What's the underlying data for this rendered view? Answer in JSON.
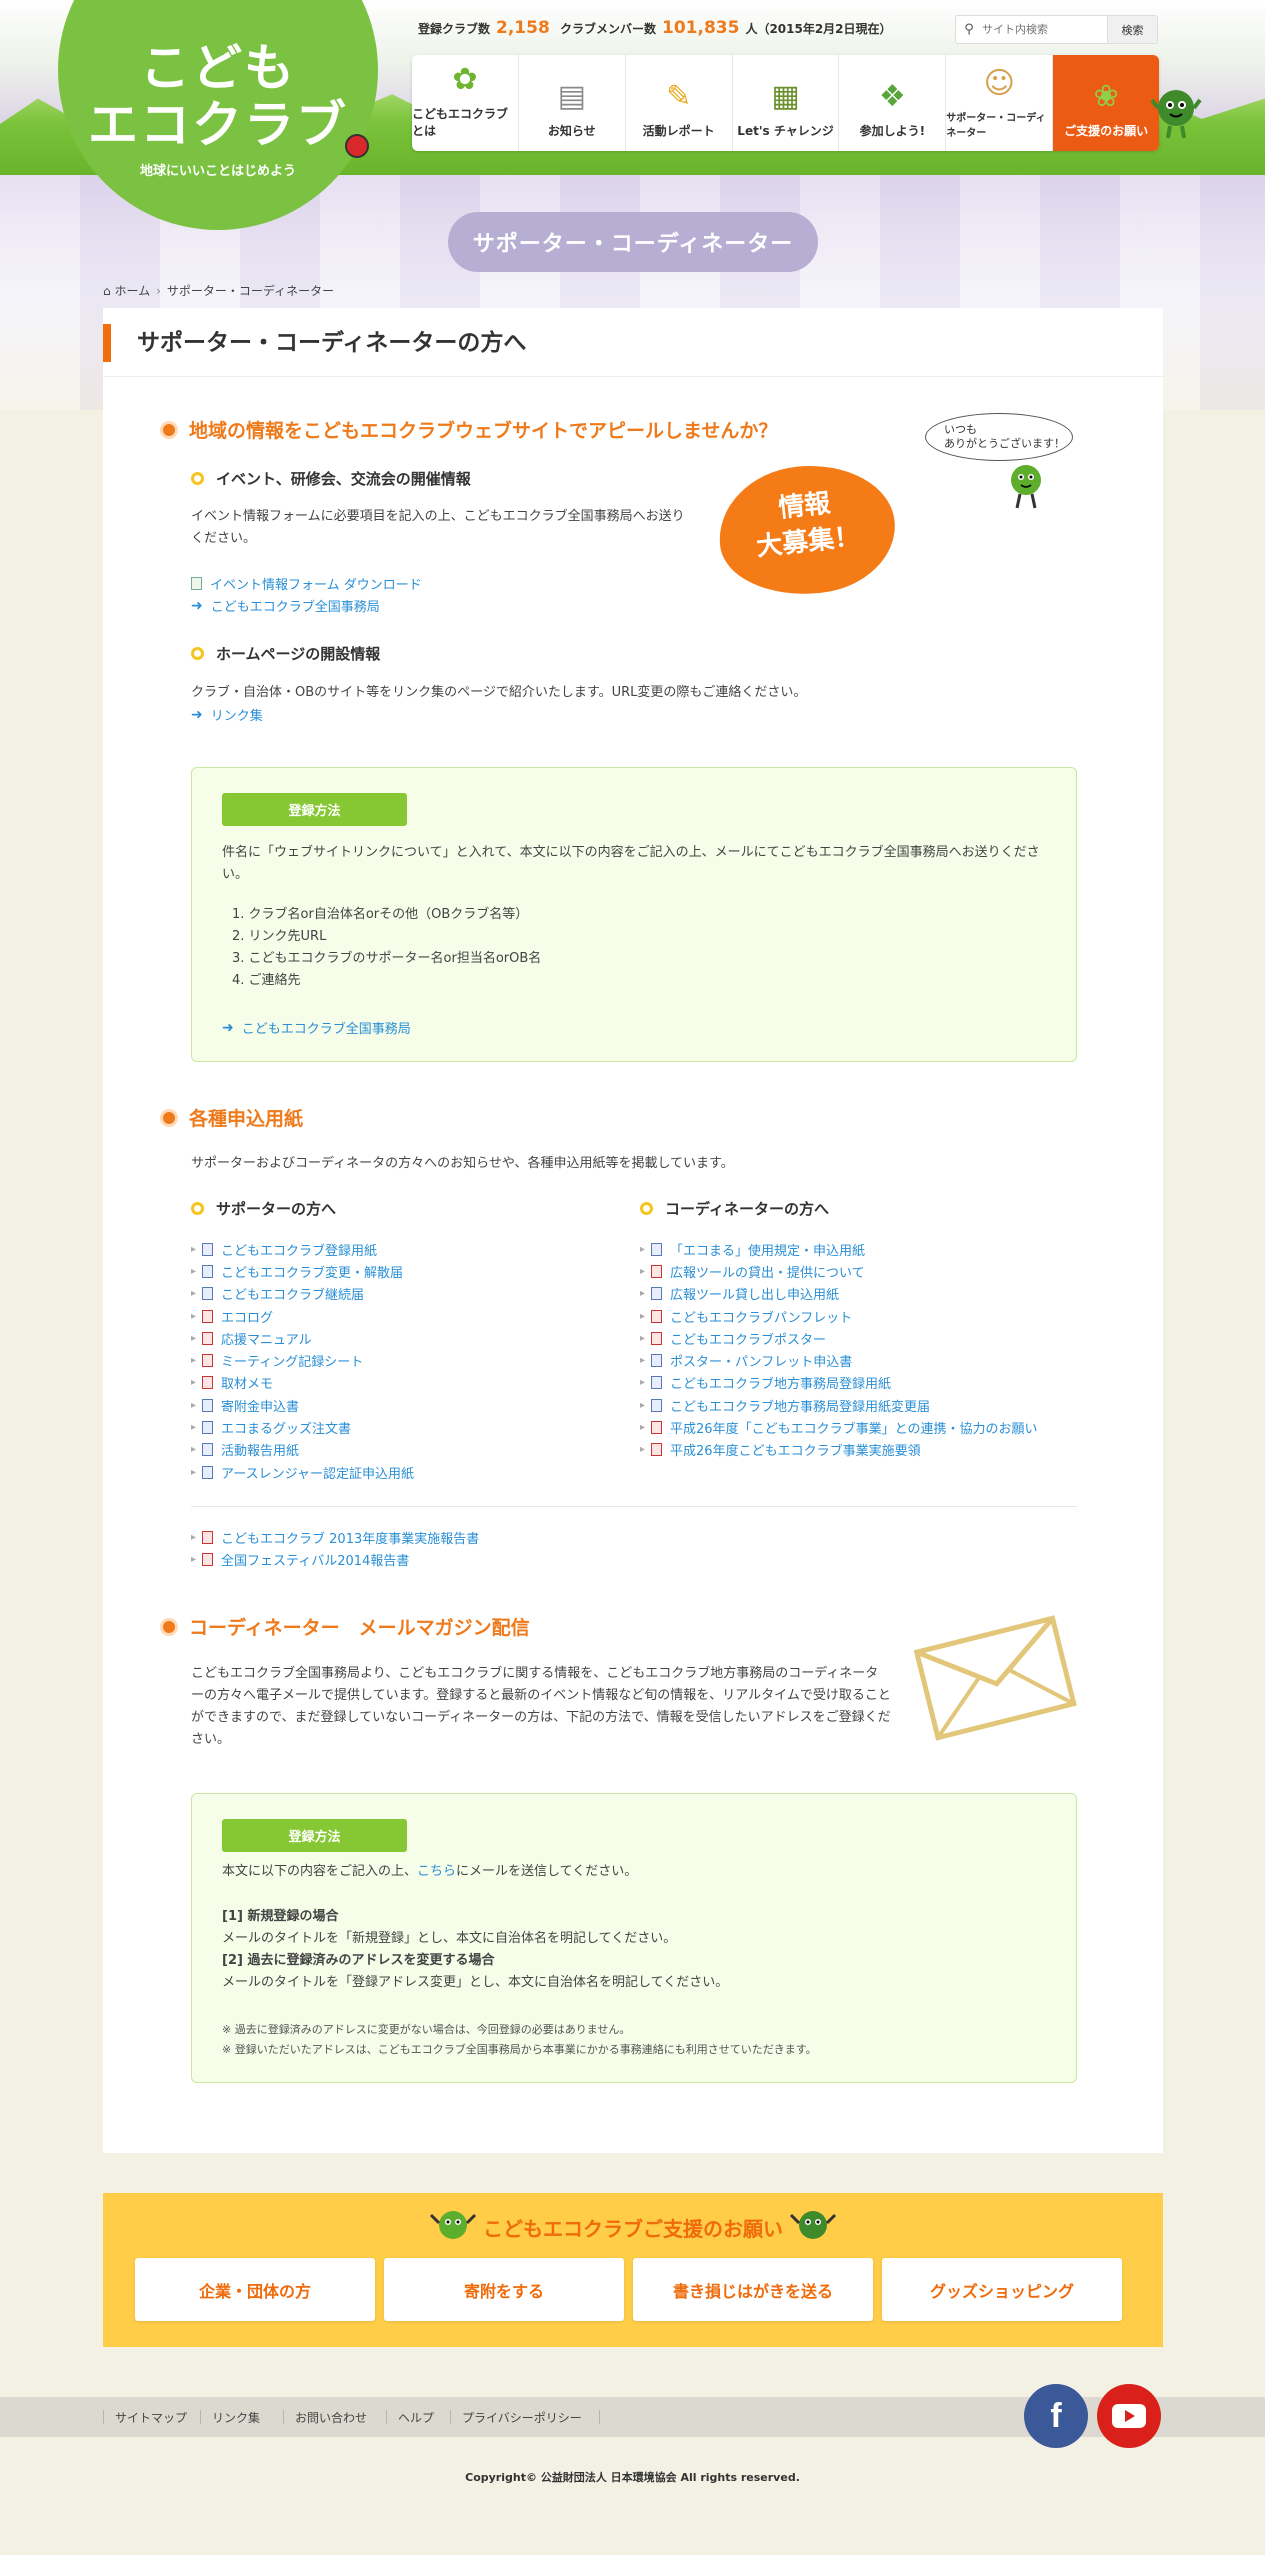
{
  "header": {
    "logo_line1": "こども",
    "logo_line2": "エコクラブ",
    "logo_tagline": "地球にいいことはじめよう",
    "stats_club_label": "登録クラブ数",
    "stats_club_count": "2,158",
    "stats_member_label": "クラブメンバー数",
    "stats_member_count": "101,835",
    "stats_member_suffix": "人（2015年2月2日現在）",
    "search_placeholder": "サイト内検索",
    "search_button": "検索",
    "nav": [
      {
        "label": "こどもエコクラブとは",
        "icon": "leaf-icon"
      },
      {
        "label": "お知らせ",
        "icon": "newspaper-icon"
      },
      {
        "label": "活動レポート",
        "icon": "pencil-icon"
      },
      {
        "label": "Let's チャレンジ",
        "icon": "chalkboard-icon"
      },
      {
        "label": "参加しよう!",
        "icon": "shoes-icon"
      },
      {
        "label": "サポーター・コーディネーター",
        "icon": "person-icon"
      },
      {
        "label": "ご支援のお願い",
        "icon": "sprout-icon"
      }
    ]
  },
  "page_title": "サポーター・コーディネーター",
  "breadcrumb": {
    "home": "ホーム",
    "current": "サポーター・コーディネーター"
  },
  "main": {
    "heading": "サポーター・コーディネーターの方へ",
    "sec1": {
      "title": "地域の情報をこどもエコクラブウェブサイトでアピールしませんか？",
      "speech": "いつも\nありがとうございます！",
      "bubble": "情報\n大募集！",
      "sub1_title": "イベント、研修会、交流会の開催情報",
      "sub1_text": "イベント情報フォームに必要項目を記入の上、こどもエコクラブ全国事務局へお送りください。",
      "sub1_link1": "イベント情報フォーム ダウンロード",
      "sub1_link2": "こどもエコクラブ全国事務局",
      "sub2_title": "ホームページの開設情報",
      "sub2_text": "クラブ・自治体・OBのサイト等をリンク集のページで紹介いたします。URL変更の際もご連絡ください。",
      "sub2_link": "リンク集",
      "box_label": "登録方法",
      "box_text": "件名に「ウェブサイトリンクについて」と入れて、本文に以下の内容をご記入の上、メールにてこどもエコクラブ全国事務局へお送りください。",
      "box_items": [
        "1. クラブ名or自治体名orその他（OBクラブ名等）",
        "2. リンク先URL",
        "3. こどもエコクラブのサポーター名or担当名orOB名",
        "4. ご連絡先"
      ],
      "box_link": "こどもエコクラブ全国事務局"
    },
    "sec2": {
      "title": "各種申込用紙",
      "text": "サポーターおよびコーディネータの方々へのお知らせや、各種申込用紙等を掲載しています。",
      "col1_title": "サポーターの方へ",
      "col1_links": [
        "こどもエコクラブ登録用紙",
        "こどもエコクラブ変更・解散届",
        "こどもエコクラブ継続届",
        "エコログ",
        "応援マニュアル",
        "ミーティング記録シート",
        "取材メモ",
        "寄附金申込書",
        "エコまるグッズ注文書",
        "活動報告用紙",
        "アースレンジャー認定証申込用紙"
      ],
      "col2_title": "コーディネーターの方へ",
      "col2_links": [
        "「エコまる」使用規定・申込用紙",
        "広報ツールの貸出・提供について",
        "広報ツール貸し出し申込用紙",
        "こどもエコクラブパンフレット",
        "こどもエコクラブポスター",
        "ポスター・パンフレット申込書",
        "こどもエコクラブ地方事務局登録用紙",
        "こどもエコクラブ地方事務局登録用紙変更届",
        "平成26年度「こどもエコクラブ事業」との連携・協力のお願い",
        "平成26年度こどもエコクラブ事業実施要領"
      ],
      "extra_links": [
        "こどもエコクラブ 2013年度事業実施報告書",
        "全国フェスティバル2014報告書"
      ]
    },
    "sec3": {
      "title": "コーディネーター　メールマガジン配信",
      "text": "こどもエコクラブ全国事務局より、こどもエコクラブに関する情報を、こどもエコクラブ地方事務局のコーディネーターの方々へ電子メールで提供しています。登録すると最新のイベント情報など旬の情報を、リアルタイムで受け取ることができますので、まだ登録していないコーディネーターの方は、下記の方法で、情報を受信したいアドレスをご登録ください。",
      "box_label": "登録方法",
      "box_text_pre": "本文に以下の内容をご記入の上、",
      "box_text_link": "こちら",
      "box_text_post": "にメールを送信してください。",
      "case1_title": "[1] 新規登録の場合",
      "case1_text": "メールのタイトルを「新規登録」とし、本文に自治体名を明記してください。",
      "case2_title": "[2] 過去に登録済みのアドレスを変更する場合",
      "case2_text": "メールのタイトルを「登録アドレス変更」とし、本文に自治体名を明記してください。",
      "note1": "※ 過去に登録済みのアドレスに変更がない場合は、今回登録の必要はありません。",
      "note2": "※ 登録いただいたアドレスは、こどもエコクラブ全国事務局から本事業にかかる事務連絡にも利用させていただきます。"
    }
  },
  "support": {
    "title": "こどもエコクラブご支援のお願い",
    "buttons": [
      "企業・団体の方",
      "寄附をする",
      "書き損じはがきを送る",
      "グッズショッピング"
    ]
  },
  "footer": {
    "links": [
      "サイトマップ",
      "リンク集",
      "お問い合わせ",
      "ヘルプ",
      "プライバシーポリシー"
    ],
    "copyright": "Copyright© 公益財団法人 日本環境協会 All rights reserved."
  },
  "colors": {
    "accent": "#ef7a1b",
    "green": "#7cc242",
    "support_bg": "#ffcd47",
    "facebook": "#3b5998",
    "youtube": "#d9201b"
  }
}
